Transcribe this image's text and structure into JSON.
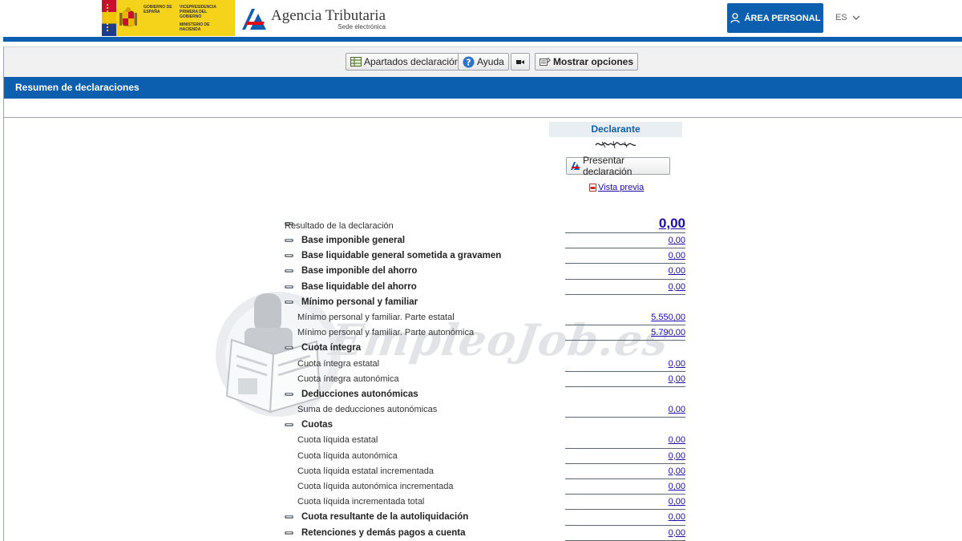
{
  "header": {
    "gov_logo": {
      "text_left": "GOBIERNO DE ESPAÑA",
      "text_right_1": "VICEPRESIDENCIA PRIMERA DEL GOBIERNO",
      "text_right_2": "MINISTERIO DE HACIENDA"
    },
    "agency_title": "Agencia Tributaria",
    "agency_subtitle": "Sede electrónica",
    "area_personal_label": "ÁREA PERSONAL",
    "language": "ES",
    "icons": {
      "user": "user-icon",
      "chevron": "chevron-down-icon"
    }
  },
  "toolbar": {
    "apartados_label": "Apartados declaración",
    "ayuda_label": "Ayuda",
    "mostrar_label": "Mostrar opciones",
    "icons": {
      "apartados": "table-icon",
      "ayuda": "help-icon",
      "video": "video-icon",
      "mostrar": "options-icon"
    }
  },
  "section_title": "Resumen de declaraciones",
  "declarante": {
    "title": "Declarante",
    "presentar_label": "Presentar declaración",
    "vista_previa_label": "Vista previa"
  },
  "summary": [
    {
      "label": "Resultado de la declaración",
      "value": "0,00",
      "type": "main"
    },
    {
      "label": "Base imponible general",
      "value": "0,00",
      "type": "head"
    },
    {
      "label": "Base liquidable general sometida a gravamen",
      "value": "0,00",
      "type": "head"
    },
    {
      "label": "Base imponible del ahorro",
      "value": "0,00",
      "type": "head"
    },
    {
      "label": "Base liquidable del ahorro",
      "value": "0,00",
      "type": "head"
    },
    {
      "label": "Mínimo personal y familiar",
      "value": "",
      "type": "head"
    },
    {
      "label": "Mínimo personal y familiar. Parte estatal",
      "value": "5.550,00",
      "type": "sub"
    },
    {
      "label": "Mínimo personal y familiar. Parte autonómica",
      "value": "5.790,00",
      "type": "sub"
    },
    {
      "label": "Cuota íntegra",
      "value": "",
      "type": "head"
    },
    {
      "label": "Cuota íntegra estatal",
      "value": "0,00",
      "type": "sub"
    },
    {
      "label": "Cuota íntegra autonómica",
      "value": "0,00",
      "type": "sub"
    },
    {
      "label": "Deducciones autonómicas",
      "value": "",
      "type": "head"
    },
    {
      "label": "Suma de deducciones autonómicas",
      "value": "0,00",
      "type": "sub"
    },
    {
      "label": "Cuotas",
      "value": "",
      "type": "head"
    },
    {
      "label": "Cuota líquida estatal",
      "value": "0,00",
      "type": "sub"
    },
    {
      "label": "Cuota líquida autonómica",
      "value": "0,00",
      "type": "sub"
    },
    {
      "label": "Cuota líquida estatal incrementada",
      "value": "0,00",
      "type": "sub"
    },
    {
      "label": "Cuota líquida autonómica incrementada",
      "value": "0,00",
      "type": "sub"
    },
    {
      "label": "Cuota líquida incrementada total",
      "value": "0,00",
      "type": "sub"
    },
    {
      "label": "Cuota resultante de la autoliquidación",
      "value": "0,00",
      "type": "head"
    },
    {
      "label": "Retenciones y demás pagos a cuenta",
      "value": "0,00",
      "type": "head"
    }
  ],
  "watermark_text": "EmpleoJob.es",
  "colors": {
    "primary_blue": "#0c5fae",
    "gov_yellow": "#f6d31b",
    "link": "#1a0dab"
  }
}
